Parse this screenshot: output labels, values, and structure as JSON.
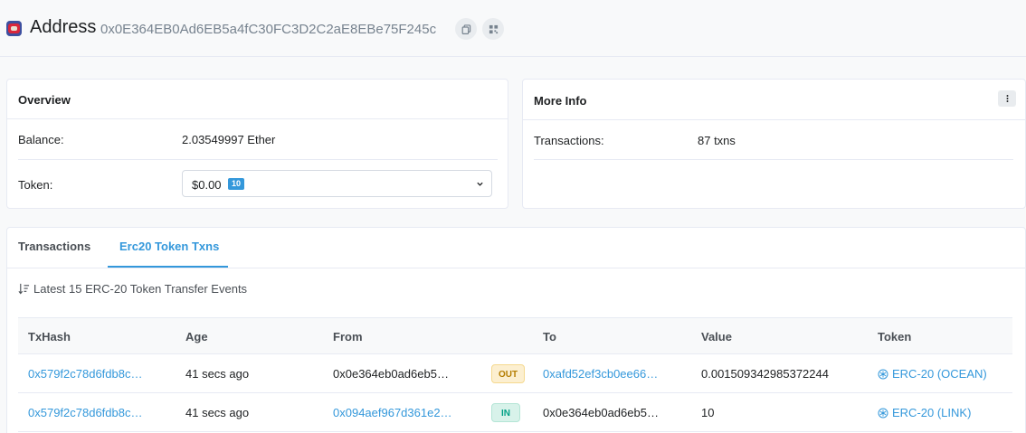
{
  "header": {
    "title": "Address",
    "address": "0x0E364EB0Ad6EB5a4fC30FC3D2C2aE8EBe75F245c",
    "copy_icon": "copy-icon",
    "qr_icon": "qr-code-icon"
  },
  "overview": {
    "title": "Overview",
    "balance_label": "Balance:",
    "balance_value": "2.03549997 Ether",
    "token_label": "Token:",
    "token_value": "$0.00",
    "token_count": "10"
  },
  "more_info": {
    "title": "More Info",
    "transactions_label": "Transactions:",
    "transactions_value": "87 txns"
  },
  "tabs": [
    {
      "label": "Transactions",
      "active": false
    },
    {
      "label": "Erc20 Token Txns",
      "active": true
    }
  ],
  "events_caption": "Latest 15 ERC-20 Token Transfer Events",
  "table": {
    "columns": [
      "TxHash",
      "Age",
      "From",
      "To",
      "Value",
      "Token"
    ],
    "rows": [
      {
        "txhash": "0x579f2c78d6fdb8c…",
        "age": "41 secs ago",
        "from": "0x0e364eb0ad6eb5…",
        "direction": "OUT",
        "to": "0xafd52ef3cb0ee66…",
        "value": "0.001509342985372244",
        "token": "ERC-20 (OCEAN)"
      },
      {
        "txhash": "0x579f2c78d6fdb8c…",
        "age": "41 secs ago",
        "from": "0x094aef967d361e2…",
        "direction": "IN",
        "to": "0x0e364eb0ad6eb5…",
        "value": "10",
        "token": "ERC-20 (LINK)"
      }
    ]
  },
  "colors": {
    "accent": "#3498db",
    "out_badge": "#fcefd0",
    "in_badge": "#d8f2ea"
  }
}
